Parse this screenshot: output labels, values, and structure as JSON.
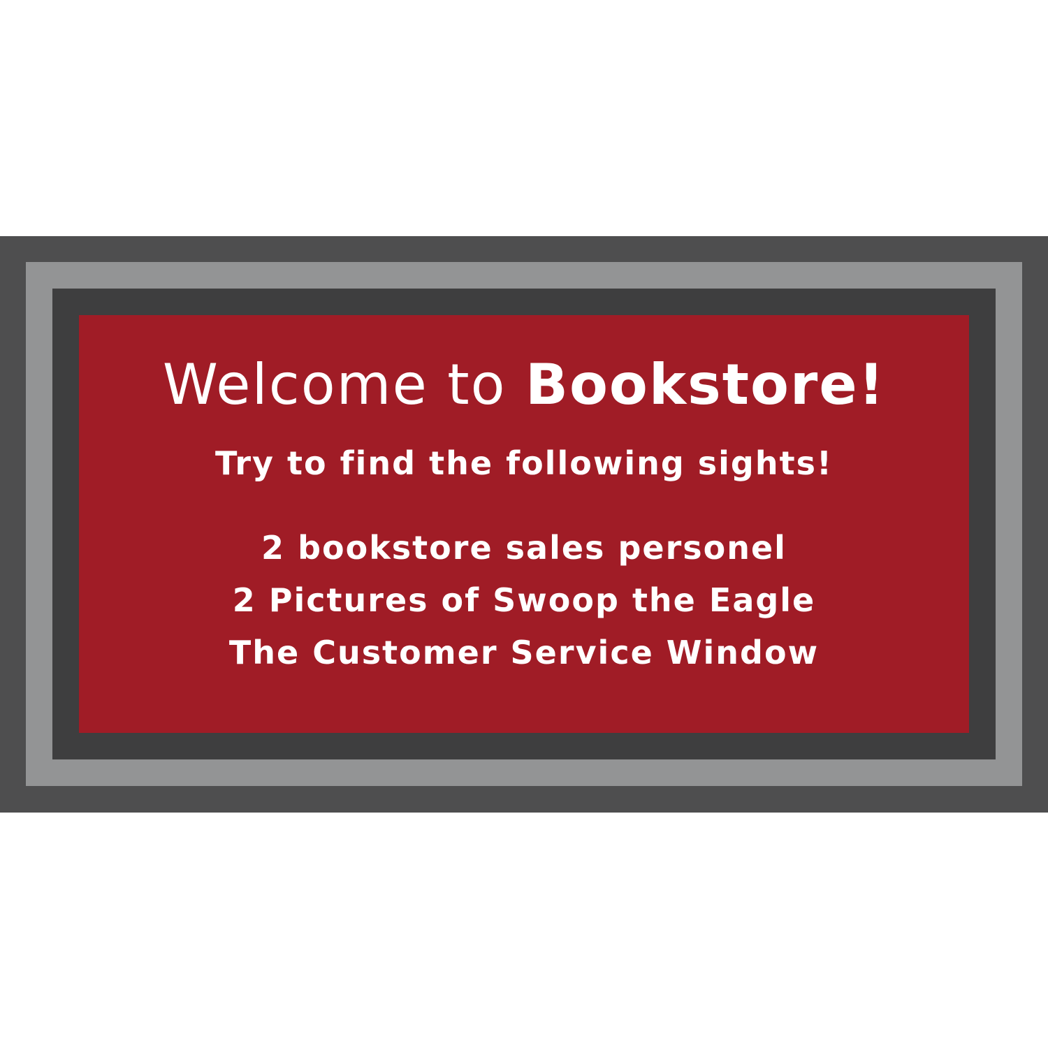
{
  "sign": {
    "title_prefix": "Welcome to ",
    "title_emphasis": "Bookstore!",
    "subtitle": "Try to find the following sights!",
    "items": [
      "2 bookstore sales personel",
      "2 Pictures of Swoop the Eagle",
      "The Customer Service Window"
    ]
  },
  "colors": {
    "background": "#ffffff",
    "outer_band": "#4e4e4f",
    "light_frame": "#939495",
    "dark_frame": "#3e3e3f",
    "panel": "#a01c26",
    "text": "#ffffff"
  }
}
